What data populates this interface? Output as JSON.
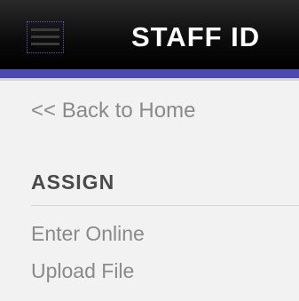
{
  "header": {
    "title": "STAFF ID",
    "menu_icon": "hamburger-menu-icon"
  },
  "nav": {
    "back_label": "<< Back to Home",
    "section_title": "ASSIGN",
    "items": [
      {
        "label": "Enter Online"
      },
      {
        "label": "Upload File"
      }
    ]
  },
  "colors": {
    "header_bg": "#000000",
    "accent": "#4b4ab3",
    "page_bg": "#f2f2f2",
    "link": "#8a8a8a"
  }
}
